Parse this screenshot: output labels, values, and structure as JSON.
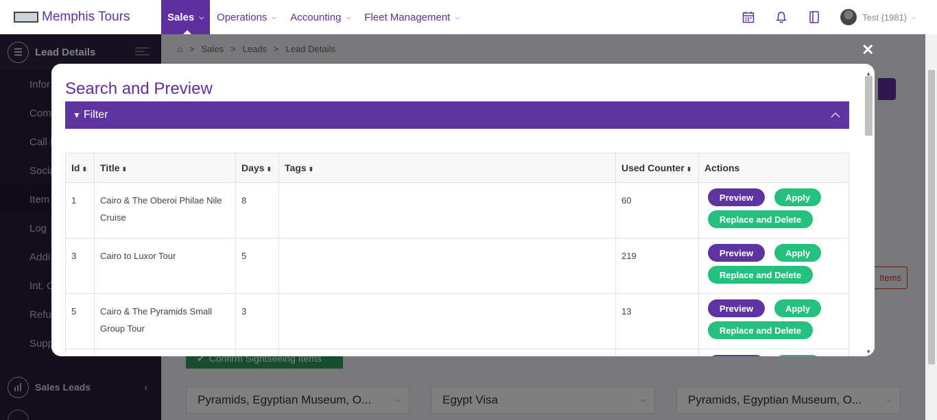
{
  "app": {
    "name": "Memphis Tours"
  },
  "topnav": {
    "items": [
      {
        "label": "Sales"
      },
      {
        "label": "Operations"
      },
      {
        "label": "Accounting"
      },
      {
        "label": "Fleet Management"
      }
    ],
    "user": "Test {1981}"
  },
  "sidebar": {
    "header": "Lead Details",
    "items": [
      {
        "label": "Infor"
      },
      {
        "label": "Comm"
      },
      {
        "label": "Call L"
      },
      {
        "label": "Socia"
      },
      {
        "label": "Item"
      },
      {
        "label": "Log"
      },
      {
        "label": "Addi"
      },
      {
        "label": "Int. C"
      },
      {
        "label": "Refu"
      },
      {
        "label": "Supp"
      }
    ],
    "sales_leads": "Sales Leads"
  },
  "breadcrumb": [
    "Sales",
    "Leads",
    "Lead Details"
  ],
  "background": {
    "items_button": "Items",
    "confirm_button": "Confirm Sightseeing Items",
    "selects": [
      "Pyramids, Egyptian Museum, O...",
      "Egypt Visa",
      "Pyramids, Egyptian Museum, O..."
    ]
  },
  "modal": {
    "title": "Search and Preview",
    "filter_label": "Filter",
    "columns": [
      "Id",
      "Title",
      "Days",
      "Tags",
      "Used Counter",
      "Actions"
    ],
    "rows": [
      {
        "id": "1",
        "title": "Cairo & The Oberoi Philae Nile Cruise",
        "days": "8",
        "tags": "",
        "used": "60"
      },
      {
        "id": "3",
        "title": "Cairo to Luxor Tour",
        "days": "5",
        "tags": "",
        "used": "219"
      },
      {
        "id": "5",
        "title": "Cairo & The Pyramids Small Group Tour",
        "days": "3",
        "tags": "",
        "used": "13"
      }
    ],
    "actions": {
      "preview": "Preview",
      "apply": "Apply",
      "replace": "Replace and Delete"
    }
  },
  "colors": {
    "brand": "#5e2f9e",
    "green": "#25bf7e",
    "sidebar": "#261b38"
  }
}
